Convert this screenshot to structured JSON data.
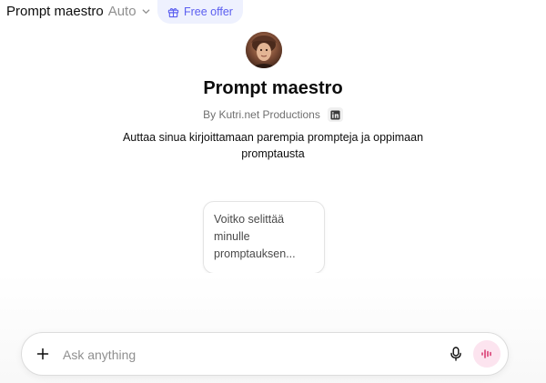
{
  "header": {
    "model_name": "Prompt maestro",
    "model_mode": "Auto",
    "offer_label": "Free offer"
  },
  "gpt": {
    "title": "Prompt maestro",
    "byline": "By Kutri.net Productions",
    "description": "Auttaa sinua kirjoittamaan parempia prompteja ja oppimaan promptausta"
  },
  "starters": [
    {
      "text": "Voitko selittää minulle promptauksen..."
    }
  ],
  "composer": {
    "placeholder": "Ask anything"
  },
  "icons": {
    "chevron": "chevron-down-icon",
    "offer": "gift-icon",
    "linkedin": "linkedin-icon",
    "plus": "plus-icon",
    "mic": "microphone-icon",
    "voice": "voice-waveform-icon"
  },
  "colors": {
    "accent": "#5b5ef0",
    "offer_bg": "#eef1fe",
    "voice_bg": "#fce4ef",
    "voice_fg": "#d6336c"
  }
}
